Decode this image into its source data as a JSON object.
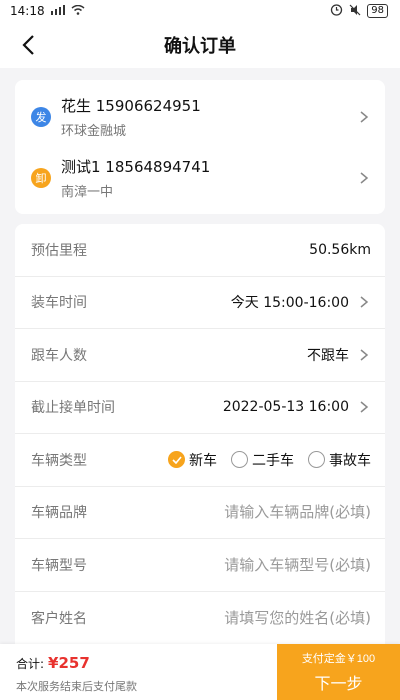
{
  "status": {
    "time": "14:18",
    "battery": "98"
  },
  "nav": {
    "title": "确认订单"
  },
  "addresses": [
    {
      "badge": "发",
      "color": "#3d86e6",
      "contact": "花生 15906624951",
      "place": "环球金融城"
    },
    {
      "badge": "卸",
      "color": "#f7a41d",
      "contact": "测试1 18564894741",
      "place": "南漳一中"
    }
  ],
  "form": {
    "mileage": {
      "label": "预估里程",
      "value": "50.56km"
    },
    "load_time": {
      "label": "装车时间",
      "value": "今天 15:00-16:00"
    },
    "riders": {
      "label": "跟车人数",
      "value": "不跟车"
    },
    "deadline": {
      "label": "截止接单时间",
      "value": "2022-05-13 16:00"
    },
    "vehicle_type": {
      "label": "车辆类型",
      "options": [
        "新车",
        "二手车",
        "事故车"
      ],
      "selected": "新车"
    },
    "brand": {
      "label": "车辆品牌",
      "placeholder": "请输入车辆品牌(必填)"
    },
    "model": {
      "label": "车辆型号",
      "placeholder": "请输入车辆型号(必填)"
    },
    "customer": {
      "label": "客户姓名",
      "placeholder": "请填写您的姓名(必填)"
    }
  },
  "footer": {
    "total_label": "合计:",
    "total_value": "¥257",
    "note": "本次服务结束后支付尾款",
    "button_sub": "支付定金￥100",
    "button_main": "下一步"
  },
  "colors": {
    "accent": "#f7a41d",
    "price": "#e8322e",
    "pickup_badge": "#3d86e6"
  }
}
